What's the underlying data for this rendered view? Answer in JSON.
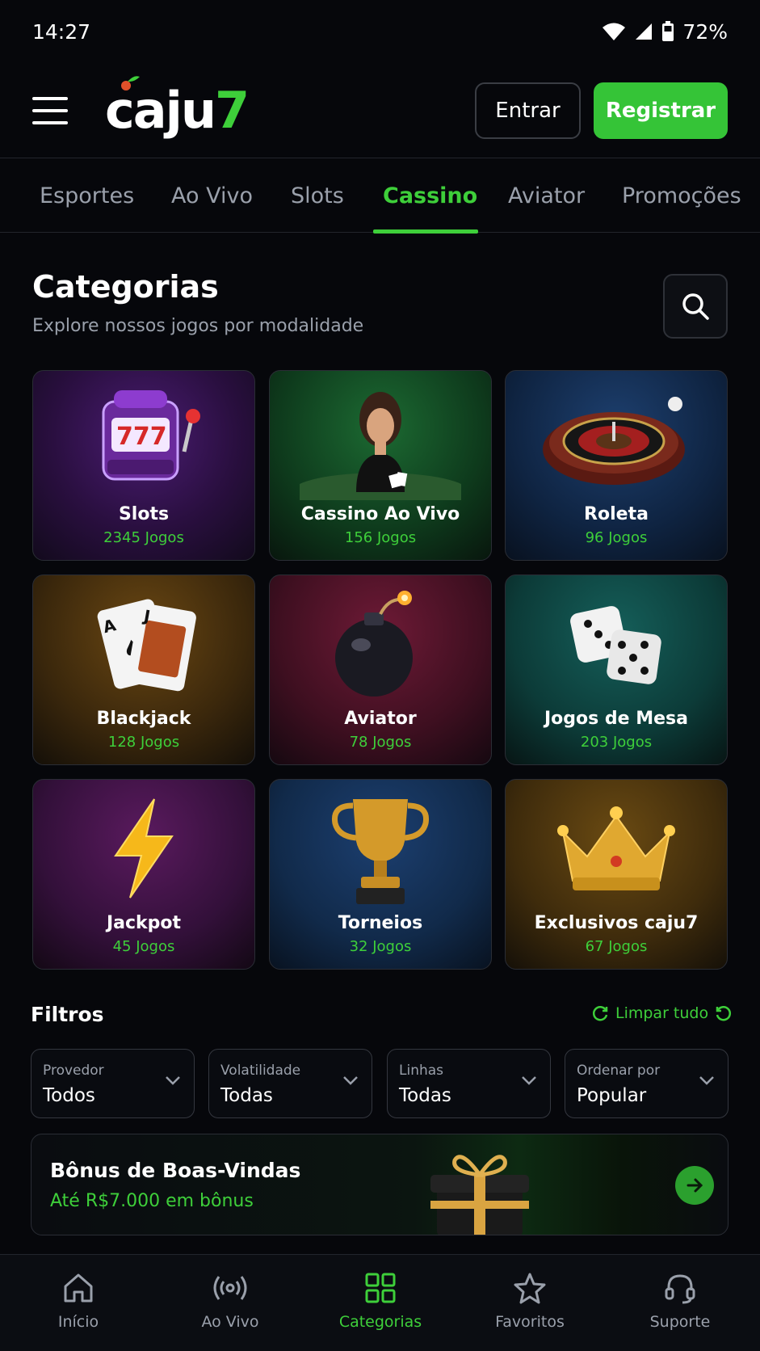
{
  "status_bar": {
    "time": "14:27",
    "battery": "72%"
  },
  "header": {
    "logo_main": "caju",
    "logo_accent": "7",
    "login_label": "Entrar",
    "register_label": "Registrar"
  },
  "tabs": [
    {
      "label": "Esportes",
      "active": false
    },
    {
      "label": "Ao Vivo",
      "active": false
    },
    {
      "label": "Slots",
      "active": false
    },
    {
      "label": "Cassino",
      "active": true
    },
    {
      "label": "Aviator",
      "active": false
    },
    {
      "label": "Promoções",
      "active": false
    }
  ],
  "categories_section": {
    "title": "Categorias",
    "subtitle": "Explore nossos jogos por modalidade"
  },
  "categories": [
    {
      "name": "Slots",
      "count": "2345 Jogos",
      "icon": "slot-machine-icon",
      "color": "#3a1658"
    },
    {
      "name": "Cassino Ao Vivo",
      "count": "156 Jogos",
      "icon": "live-dealer-icon",
      "color": "#0f4a22"
    },
    {
      "name": "Roleta",
      "count": "96 Jogos",
      "icon": "roulette-icon",
      "color": "#123055"
    },
    {
      "name": "Blackjack",
      "count": "128 Jogos",
      "icon": "cards-icon",
      "color": "#4a320c"
    },
    {
      "name": "Aviator",
      "count": "78 Jogos",
      "icon": "bomb-icon",
      "color": "#4d0f24"
    },
    {
      "name": "Jogos de Mesa",
      "count": "203 Jogos",
      "icon": "dice-icon",
      "color": "#0c4440"
    },
    {
      "name": "Jackpot",
      "count": "45 Jogos",
      "icon": "lightning-icon",
      "color": "#3e1042"
    },
    {
      "name": "Torneios",
      "count": "32 Jogos",
      "icon": "trophy-icon",
      "color": "#102c52"
    },
    {
      "name": "Exclusivos caju7",
      "count": "67 Jogos",
      "icon": "crown-icon",
      "color": "#4c330b"
    }
  ],
  "filters": {
    "title": "Filtros",
    "clear_label": "Limpar tudo",
    "items": [
      {
        "label": "Provedor",
        "value": "Todos"
      },
      {
        "label": "Volatilidade",
        "value": "Todas"
      },
      {
        "label": "Linhas",
        "value": "Todas"
      },
      {
        "label": "Ordenar por",
        "value": "Popular"
      }
    ]
  },
  "bonus": {
    "title": "Bônus de Boas-Vindas",
    "subtitle": "Até R$7.000 em bônus"
  },
  "bottom_nav": [
    {
      "label": "Início",
      "icon": "home-icon",
      "active": false
    },
    {
      "label": "Ao Vivo",
      "icon": "broadcast-icon",
      "active": false
    },
    {
      "label": "Categorias",
      "icon": "grid-icon",
      "active": true
    },
    {
      "label": "Favoritos",
      "icon": "star-icon",
      "active": false
    },
    {
      "label": "Suporte",
      "icon": "headset-icon",
      "active": false
    }
  ],
  "colors": {
    "accent": "#3ecf3a",
    "background": "#06070b"
  }
}
